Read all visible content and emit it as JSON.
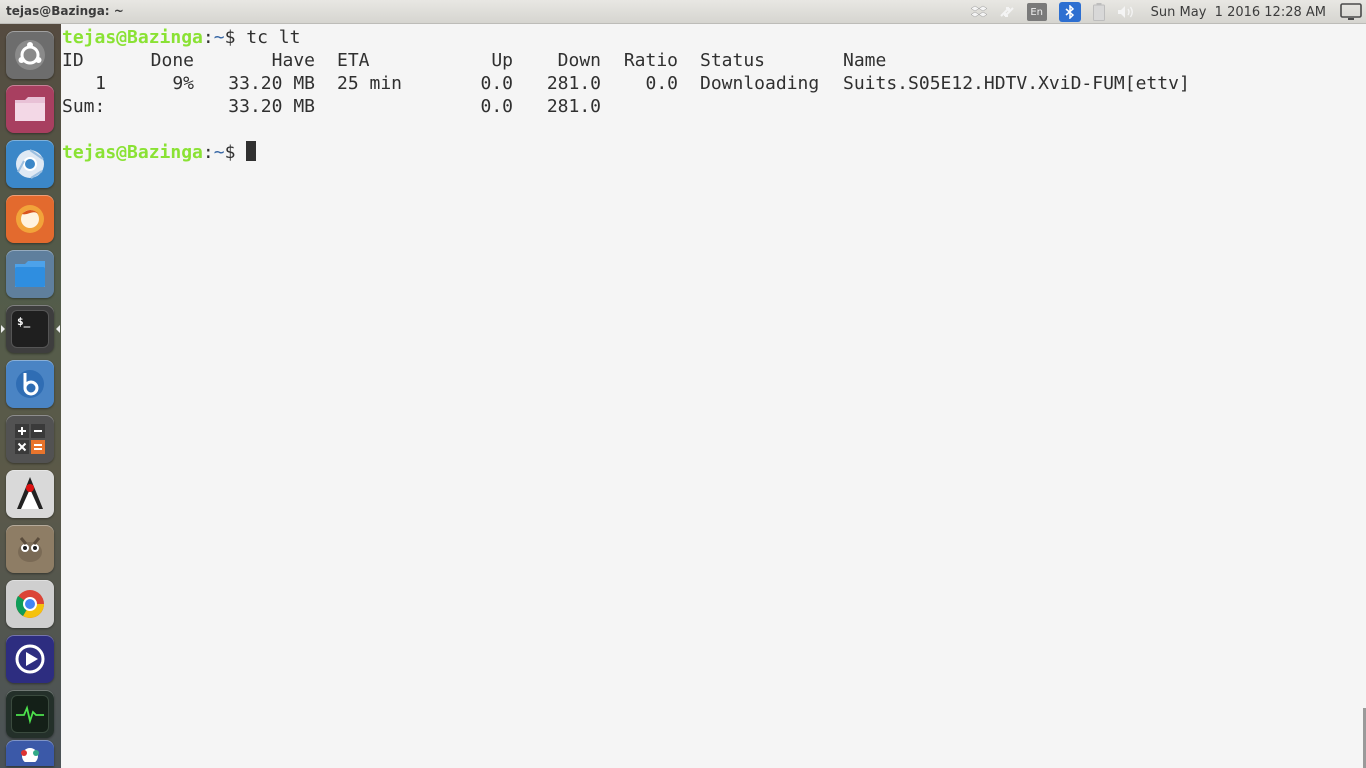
{
  "window": {
    "title": "tejas@Bazinga: ~"
  },
  "panel": {
    "language": "En",
    "clock": "Sun May  1 2016 12:28 AM",
    "indicators": [
      "dropbox-icon",
      "transfer-icon",
      "keyboard-language-icon",
      "bluetooth-icon",
      "battery-icon",
      "volume-icon",
      "session-icon"
    ]
  },
  "launcher": {
    "items": [
      {
        "name": "ubuntu-dash",
        "color": "#6a6a6a"
      },
      {
        "name": "files",
        "color": "#b2486a"
      },
      {
        "name": "chromium",
        "color": "#2f7fc2"
      },
      {
        "name": "firefox",
        "color": "#e0662c"
      },
      {
        "name": "file-manager-folder",
        "color": "#3a8ad8"
      },
      {
        "name": "terminal",
        "color": "#2b2b2b"
      },
      {
        "name": "app-b",
        "color": "#3a79c6"
      },
      {
        "name": "calculator",
        "color": "#4a4a4a"
      },
      {
        "name": "java-duke",
        "color": "#d8d8d8"
      },
      {
        "name": "gimp",
        "color": "#8c7a62"
      },
      {
        "name": "google-chrome",
        "color": "#d0d0d0"
      },
      {
        "name": "media-player",
        "color": "#2a2a7a"
      },
      {
        "name": "system-monitor",
        "color": "#1e2a22"
      },
      {
        "name": "app-bottom",
        "color": "#3b59a8"
      }
    ]
  },
  "terminal": {
    "prompt_user": "tejas@Bazinga",
    "prompt_sep": ":",
    "prompt_path": "~",
    "prompt_symbol": "$",
    "command": "tc lt",
    "headers": [
      "ID",
      "Done",
      "Have",
      "ETA",
      "Up",
      "Down",
      "Ratio",
      "Status",
      "Name"
    ],
    "rows": [
      {
        "id": "1",
        "done": "9%",
        "have": "33.20 MB",
        "eta": "25 min",
        "up": "0.0",
        "down": "281.0",
        "ratio": "0.0",
        "status": "Downloading",
        "name": "Suits.S05E12.HDTV.XviD-FUM[ettv]"
      }
    ],
    "sum": {
      "label": "Sum:",
      "have": "33.20 MB",
      "up": "0.0",
      "down": "281.0"
    }
  }
}
